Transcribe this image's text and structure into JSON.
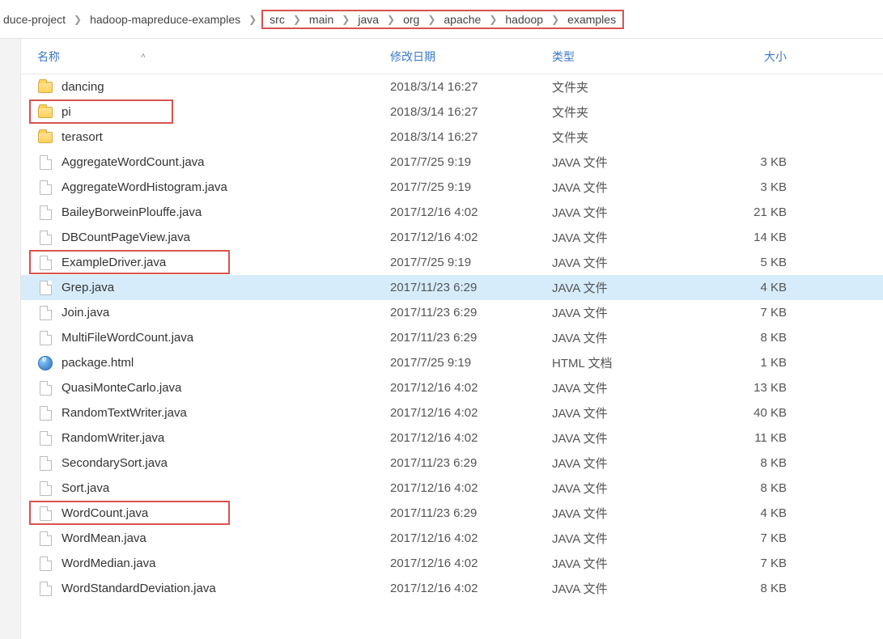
{
  "breadcrumb": {
    "items": [
      {
        "label": "duce-project"
      },
      {
        "label": "hadoop-mapreduce-examples"
      },
      {
        "label": "src"
      },
      {
        "label": "main"
      },
      {
        "label": "java"
      },
      {
        "label": "org"
      },
      {
        "label": "apache"
      },
      {
        "label": "hadoop"
      },
      {
        "label": "examples"
      }
    ]
  },
  "columns": {
    "name": "名称",
    "date": "修改日期",
    "type": "类型",
    "size": "大小"
  },
  "files": [
    {
      "name": "dancing",
      "date": "2018/3/14 16:27",
      "type": "文件夹",
      "size": "",
      "icon": "folder",
      "selected": false
    },
    {
      "name": "pi",
      "date": "2018/3/14 16:27",
      "type": "文件夹",
      "size": "",
      "icon": "folder",
      "selected": false
    },
    {
      "name": "terasort",
      "date": "2018/3/14 16:27",
      "type": "文件夹",
      "size": "",
      "icon": "folder",
      "selected": false
    },
    {
      "name": "AggregateWordCount.java",
      "date": "2017/7/25 9:19",
      "type": "JAVA 文件",
      "size": "3 KB",
      "icon": "doc",
      "selected": false
    },
    {
      "name": "AggregateWordHistogram.java",
      "date": "2017/7/25 9:19",
      "type": "JAVA 文件",
      "size": "3 KB",
      "icon": "doc",
      "selected": false
    },
    {
      "name": "BaileyBorweinPlouffe.java",
      "date": "2017/12/16 4:02",
      "type": "JAVA 文件",
      "size": "21 KB",
      "icon": "doc",
      "selected": false
    },
    {
      "name": "DBCountPageView.java",
      "date": "2017/12/16 4:02",
      "type": "JAVA 文件",
      "size": "14 KB",
      "icon": "doc",
      "selected": false
    },
    {
      "name": "ExampleDriver.java",
      "date": "2017/7/25 9:19",
      "type": "JAVA 文件",
      "size": "5 KB",
      "icon": "doc",
      "selected": false
    },
    {
      "name": "Grep.java",
      "date": "2017/11/23 6:29",
      "type": "JAVA 文件",
      "size": "4 KB",
      "icon": "doc",
      "selected": true
    },
    {
      "name": "Join.java",
      "date": "2017/11/23 6:29",
      "type": "JAVA 文件",
      "size": "7 KB",
      "icon": "doc",
      "selected": false
    },
    {
      "name": "MultiFileWordCount.java",
      "date": "2017/11/23 6:29",
      "type": "JAVA 文件",
      "size": "8 KB",
      "icon": "doc",
      "selected": false
    },
    {
      "name": "package.html",
      "date": "2017/7/25 9:19",
      "type": "HTML 文档",
      "size": "1 KB",
      "icon": "html",
      "selected": false
    },
    {
      "name": "QuasiMonteCarlo.java",
      "date": "2017/12/16 4:02",
      "type": "JAVA 文件",
      "size": "13 KB",
      "icon": "doc",
      "selected": false
    },
    {
      "name": "RandomTextWriter.java",
      "date": "2017/12/16 4:02",
      "type": "JAVA 文件",
      "size": "40 KB",
      "icon": "doc",
      "selected": false
    },
    {
      "name": "RandomWriter.java",
      "date": "2017/12/16 4:02",
      "type": "JAVA 文件",
      "size": "11 KB",
      "icon": "doc",
      "selected": false
    },
    {
      "name": "SecondarySort.java",
      "date": "2017/11/23 6:29",
      "type": "JAVA 文件",
      "size": "8 KB",
      "icon": "doc",
      "selected": false
    },
    {
      "name": "Sort.java",
      "date": "2017/12/16 4:02",
      "type": "JAVA 文件",
      "size": "8 KB",
      "icon": "doc",
      "selected": false
    },
    {
      "name": "WordCount.java",
      "date": "2017/11/23 6:29",
      "type": "JAVA 文件",
      "size": "4 KB",
      "icon": "doc",
      "selected": false
    },
    {
      "name": "WordMean.java",
      "date": "2017/12/16 4:02",
      "type": "JAVA 文件",
      "size": "7 KB",
      "icon": "doc",
      "selected": false
    },
    {
      "name": "WordMedian.java",
      "date": "2017/12/16 4:02",
      "type": "JAVA 文件",
      "size": "7 KB",
      "icon": "doc",
      "selected": false
    },
    {
      "name": "WordStandardDeviation.java",
      "date": "2017/12/16 4:02",
      "type": "JAVA 文件",
      "size": "8 KB",
      "icon": "doc",
      "selected": false
    }
  ]
}
